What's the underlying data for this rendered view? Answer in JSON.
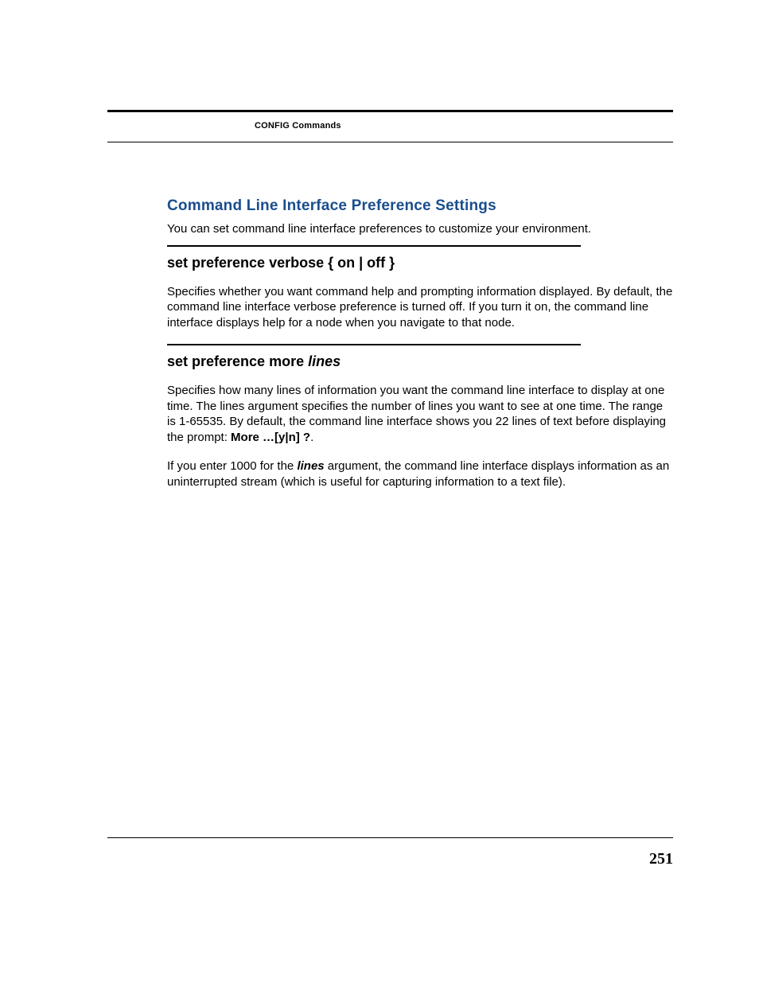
{
  "header": {
    "label": "CONFIG Commands"
  },
  "section": {
    "title": "Command Line Interface Preference Settings",
    "intro": "You can set command line interface preferences to customize your environment."
  },
  "cmd1": {
    "heading": "set preference verbose { on | off }",
    "para": "Specifies whether you want command help and prompting information displayed. By default, the command line interface verbose preference is turned off. If you turn it on, the command line interface displays help for a node when you navigate to that node."
  },
  "cmd2": {
    "heading_prefix": "set preference more ",
    "heading_em": "lines",
    "para1_a": "Specifies how many lines of information you want the command line interface to display at one time. The lines argument specifies the number of lines you want to see at one time. The range is 1-65535. By default, the command line interface shows you 22 lines of text before displaying the prompt: ",
    "para1_b_bold": "More …[y|n] ?",
    "para1_c": ".",
    "para2_a": "If you enter 1000 for the ",
    "para2_b_bi": "lines",
    "para2_c": " argument, the command line interface displays information as an uninterrupted stream (which is useful for capturing information to a text file)."
  },
  "footer": {
    "page_number": "251"
  }
}
